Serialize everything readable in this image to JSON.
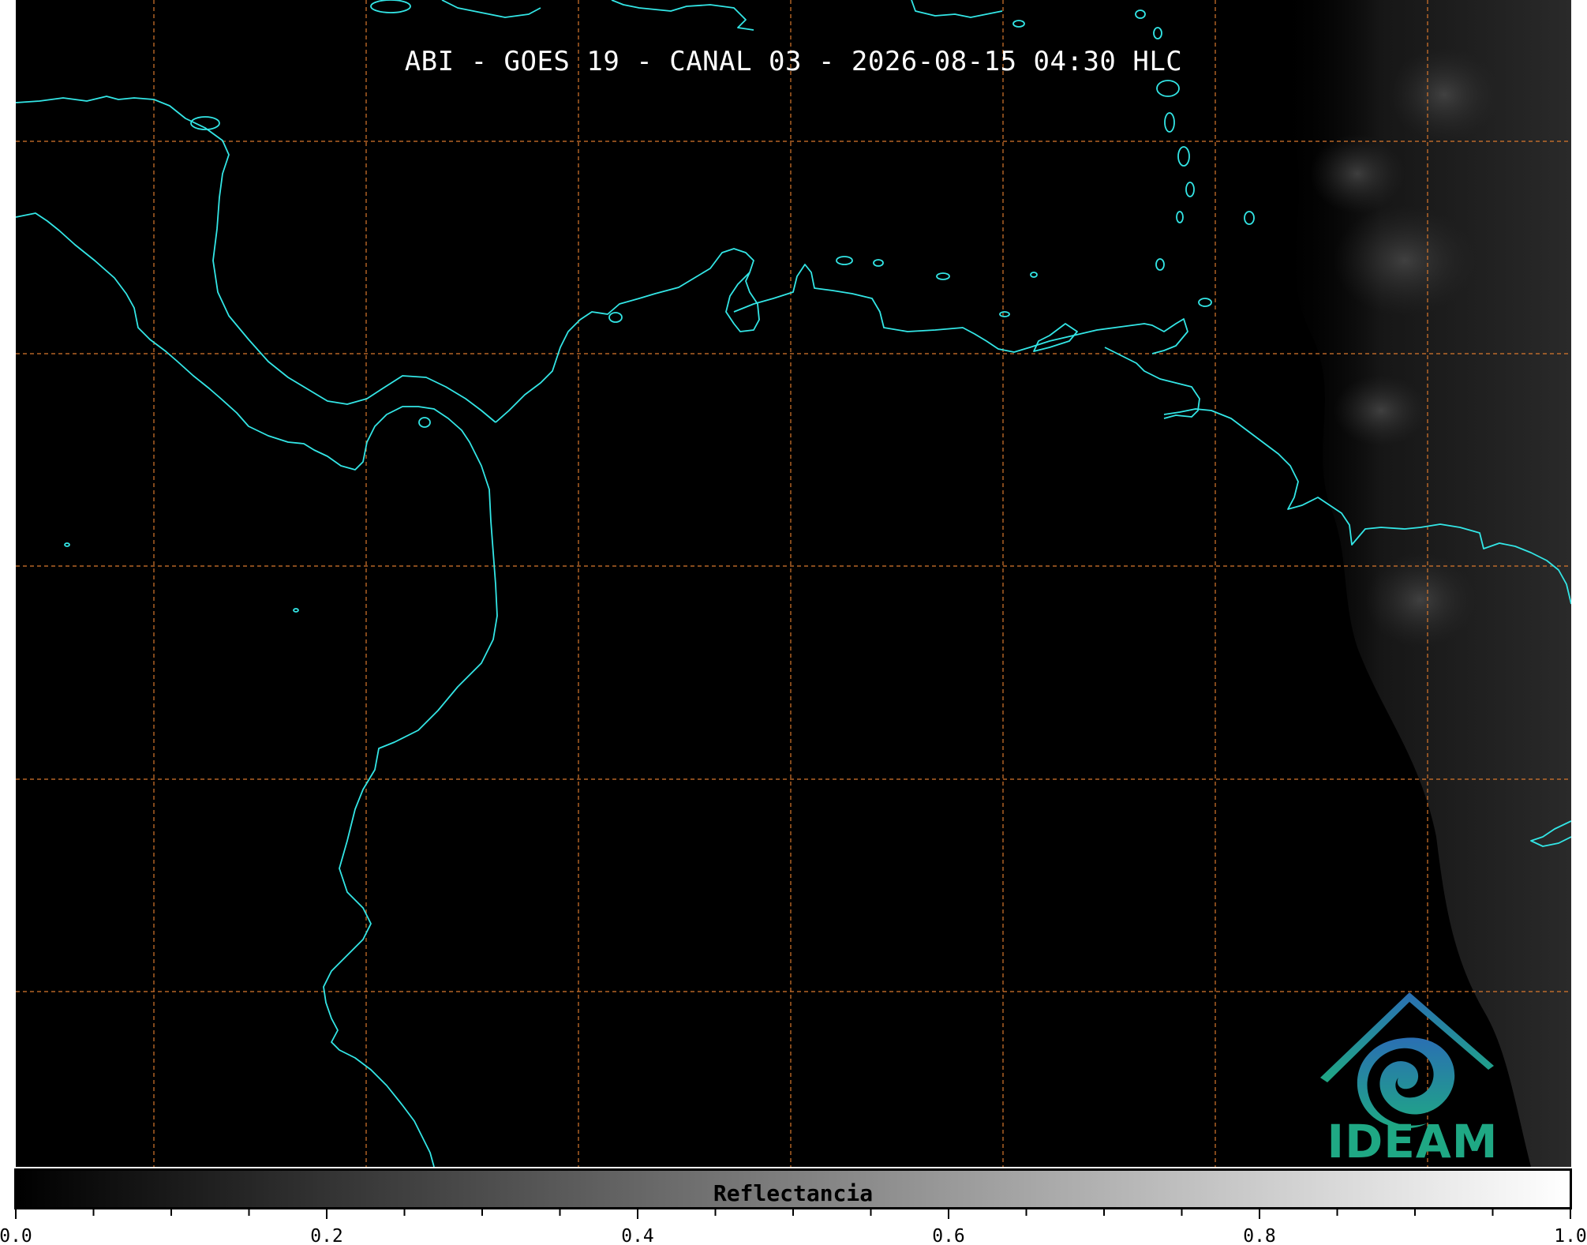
{
  "title": "ABI - GOES 19 - CANAL 03 - 2026-08-15 04:30 HLC",
  "logo": {
    "text": "IDEAM",
    "icon": "ideam-logo-icon",
    "colors": {
      "teal": "#1fa884",
      "blue": "#2a6fb3"
    }
  },
  "colorbar": {
    "label": "Reflectancia",
    "min": 0.0,
    "max": 1.0,
    "colormap": "grayscale",
    "major_ticks": [
      "0.0",
      "0.2",
      "0.4",
      "0.6",
      "0.8",
      "1.0"
    ],
    "minor_tick_step": 0.05
  },
  "map": {
    "background": "#000000",
    "coastline_color": "#33e6e6",
    "gridline_color": "#d9782d",
    "gridline_style": "dashed",
    "icon": "satellite-imagery"
  }
}
